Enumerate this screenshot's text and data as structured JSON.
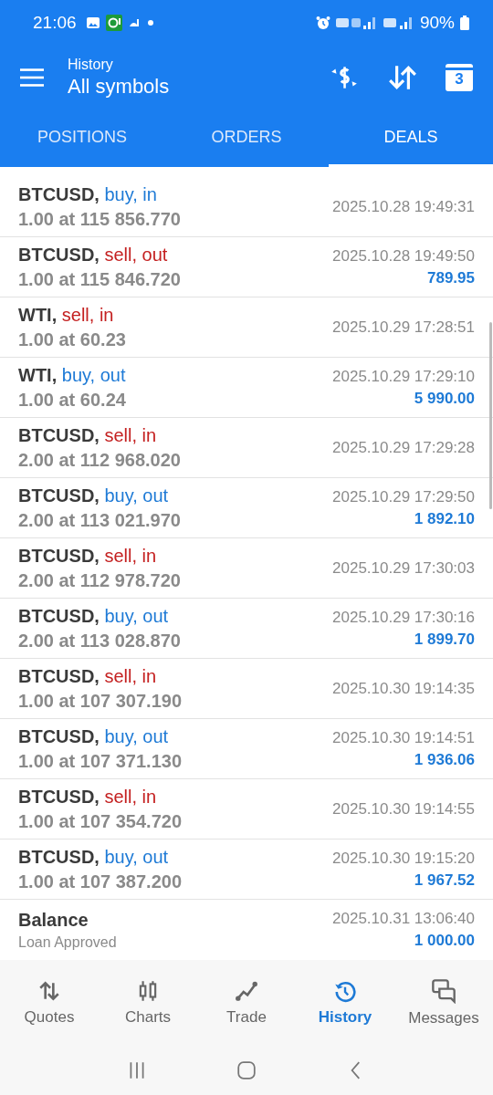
{
  "status_bar": {
    "time": "21:06",
    "battery": "90%"
  },
  "toolbar": {
    "subtitle": "History",
    "title": "All symbols",
    "calendar_day": "3"
  },
  "tabs": [
    {
      "label": "POSITIONS",
      "selected": false
    },
    {
      "label": "ORDERS",
      "selected": false
    },
    {
      "label": "DEALS",
      "selected": true
    }
  ],
  "deals": [
    {
      "kind": "buy",
      "symbol": "BTCUSD,",
      "type": "buy, in",
      "volume": "1.00 at 115 856.770",
      "time": "2025.10.28 19:49:31"
    },
    {
      "kind": "sell",
      "symbol": "BTCUSD,",
      "type": "sell, out",
      "volume": "1.00 at 115 846.720",
      "time": "2025.10.28 19:49:50",
      "profit": "789.95"
    },
    {
      "kind": "sell",
      "symbol": "WTI,",
      "type": "sell, in",
      "volume": "1.00 at 60.23",
      "time": "2025.10.29 17:28:51"
    },
    {
      "kind": "buy",
      "symbol": "WTI,",
      "type": "buy, out",
      "volume": "1.00 at 60.24",
      "time": "2025.10.29 17:29:10",
      "profit": "5 990.00"
    },
    {
      "kind": "sell",
      "symbol": "BTCUSD,",
      "type": "sell, in",
      "volume": "2.00 at 112 968.020",
      "time": "2025.10.29 17:29:28"
    },
    {
      "kind": "buy",
      "symbol": "BTCUSD,",
      "type": "buy, out",
      "volume": "2.00 at 113 021.970",
      "time": "2025.10.29 17:29:50",
      "profit": "1 892.10"
    },
    {
      "kind": "sell",
      "symbol": "BTCUSD,",
      "type": "sell, in",
      "volume": "2.00 at 112 978.720",
      "time": "2025.10.29 17:30:03"
    },
    {
      "kind": "buy",
      "symbol": "BTCUSD,",
      "type": "buy, out",
      "volume": "2.00 at 113 028.870",
      "time": "2025.10.29 17:30:16",
      "profit": "1 899.70"
    },
    {
      "kind": "sell",
      "symbol": "BTCUSD,",
      "type": "sell, in",
      "volume": "1.00 at 107 307.190",
      "time": "2025.10.30 19:14:35"
    },
    {
      "kind": "buy",
      "symbol": "BTCUSD,",
      "type": "buy, out",
      "volume": "1.00 at 107 371.130",
      "time": "2025.10.30 19:14:51",
      "profit": "1 936.06"
    },
    {
      "kind": "sell",
      "symbol": "BTCUSD,",
      "type": "sell, in",
      "volume": "1.00 at 107 354.720",
      "time": "2025.10.30 19:14:55"
    },
    {
      "kind": "buy",
      "symbol": "BTCUSD,",
      "type": "buy, out",
      "volume": "1.00 at 107 387.200",
      "time": "2025.10.30 19:15:20",
      "profit": "1 967.52"
    },
    {
      "kind": "balance",
      "symbol": "Balance",
      "volume": "Loan Approved",
      "time": "2025.10.31 13:06:40",
      "profit": "1 000.00"
    }
  ],
  "bottom_nav": [
    {
      "label": "Quotes",
      "selected": false
    },
    {
      "label": "Charts",
      "selected": false
    },
    {
      "label": "Trade",
      "selected": false
    },
    {
      "label": "History",
      "selected": true
    },
    {
      "label": "Messages",
      "selected": false
    }
  ]
}
